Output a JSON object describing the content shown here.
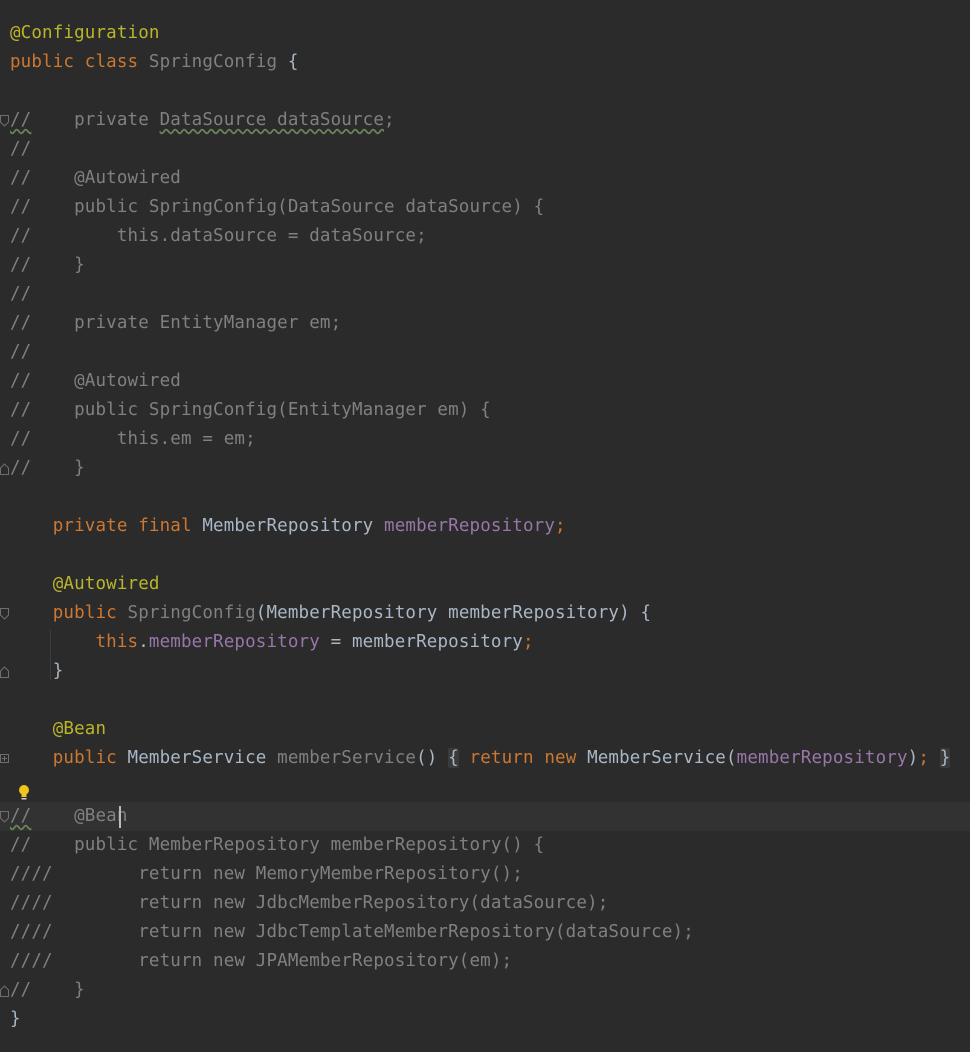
{
  "editor": {
    "language": "java",
    "colors": {
      "background": "#2b2b2b",
      "text": "#a9b7c6",
      "keyword": "#cc7832",
      "annotation": "#bbb529",
      "field": "#9876aa",
      "comment": "#808080"
    },
    "lines": [
      {
        "segs": [
          {
            "t": "@Configuration",
            "c": "ann"
          }
        ]
      },
      {
        "segs": [
          {
            "t": "public class ",
            "c": "kw"
          },
          {
            "t": "SpringConfig",
            "c": "muted"
          },
          {
            "t": " {",
            "c": "txt"
          }
        ]
      },
      {
        "segs": []
      },
      {
        "fold": "start",
        "segs": [
          {
            "t": "//",
            "c": "cmt",
            "u": true
          },
          {
            "t": "    private ",
            "c": "cmt"
          },
          {
            "t": "DataSource dataSource",
            "c": "cmt",
            "u": true
          },
          {
            "t": ";",
            "c": "cmt"
          }
        ]
      },
      {
        "segs": [
          {
            "t": "//",
            "c": "cmt"
          }
        ]
      },
      {
        "segs": [
          {
            "t": "//    @Autowired",
            "c": "cmt"
          }
        ]
      },
      {
        "segs": [
          {
            "t": "//    public SpringConfig(DataSource dataSource) {",
            "c": "cmt"
          }
        ]
      },
      {
        "segs": [
          {
            "t": "//        this.dataSource = dataSource;",
            "c": "cmt"
          }
        ]
      },
      {
        "segs": [
          {
            "t": "//    }",
            "c": "cmt"
          }
        ]
      },
      {
        "segs": [
          {
            "t": "//",
            "c": "cmt"
          }
        ]
      },
      {
        "segs": [
          {
            "t": "//    private EntityManager em;",
            "c": "cmt"
          }
        ]
      },
      {
        "segs": [
          {
            "t": "//",
            "c": "cmt"
          }
        ]
      },
      {
        "segs": [
          {
            "t": "//    @Autowired",
            "c": "cmt"
          }
        ]
      },
      {
        "segs": [
          {
            "t": "//    public SpringConfig(EntityManager em) {",
            "c": "cmt"
          }
        ]
      },
      {
        "segs": [
          {
            "t": "//        this.em = em;",
            "c": "cmt"
          }
        ]
      },
      {
        "fold": "end",
        "segs": [
          {
            "t": "//    }",
            "c": "cmt"
          }
        ]
      },
      {
        "segs": []
      },
      {
        "segs": [
          {
            "t": "    private final ",
            "c": "kw"
          },
          {
            "t": "MemberRepository ",
            "c": "txt"
          },
          {
            "t": "memberRepository",
            "c": "field"
          },
          {
            "t": ";",
            "c": "kw"
          }
        ]
      },
      {
        "segs": []
      },
      {
        "segs": [
          {
            "t": "    @Autowired",
            "c": "ann"
          }
        ]
      },
      {
        "fold": "start",
        "segs": [
          {
            "t": "    public ",
            "c": "kw"
          },
          {
            "t": "SpringConfig",
            "c": "muted"
          },
          {
            "t": "(MemberRepository memberRepository) {",
            "c": "txt"
          }
        ]
      },
      {
        "segs": [
          {
            "t": "        this",
            "c": "kw"
          },
          {
            "t": ".",
            "c": "txt"
          },
          {
            "t": "memberRepository",
            "c": "field"
          },
          {
            "t": " = memberRepository",
            "c": "txt"
          },
          {
            "t": ";",
            "c": "kw"
          }
        ]
      },
      {
        "fold": "end",
        "segs": [
          {
            "t": "    }",
            "c": "txt"
          }
        ]
      },
      {
        "segs": []
      },
      {
        "segs": [
          {
            "t": "    @Bean",
            "c": "ann"
          }
        ]
      },
      {
        "fold": "plus",
        "segs": [
          {
            "t": "    public ",
            "c": "kw"
          },
          {
            "t": "MemberService ",
            "c": "txt"
          },
          {
            "t": "memberService",
            "c": "muted"
          },
          {
            "t": "() ",
            "c": "txt"
          },
          {
            "t": "{",
            "c": "txt",
            "box": true
          },
          {
            "t": " ",
            "c": "txt"
          },
          {
            "t": "return new ",
            "c": "kw"
          },
          {
            "t": "MemberService(",
            "c": "txt"
          },
          {
            "t": "memberRepository",
            "c": "field"
          },
          {
            "t": ")",
            "c": "txt"
          },
          {
            "t": ";",
            "c": "kw"
          },
          {
            "t": " ",
            "c": "txt"
          },
          {
            "t": "}",
            "c": "txt",
            "box": true
          }
        ]
      },
      {
        "segs": []
      },
      {
        "current": true,
        "fold": "start",
        "segs": [
          {
            "t": "//",
            "c": "cmt",
            "u": true
          },
          {
            "t": "    @Bean",
            "c": "cmt"
          }
        ]
      },
      {
        "segs": [
          {
            "t": "//    public MemberRepository memberRepository() {",
            "c": "cmt"
          }
        ]
      },
      {
        "segs": [
          {
            "t": "////        return new MemoryMemberRepository();",
            "c": "cmt"
          }
        ]
      },
      {
        "segs": [
          {
            "t": "////        return new JdbcMemberRepository(dataSource);",
            "c": "cmt"
          }
        ]
      },
      {
        "segs": [
          {
            "t": "////        return new JdbcTemplateMemberRepository(dataSource);",
            "c": "cmt"
          }
        ]
      },
      {
        "segs": [
          {
            "t": "////        return new JPAMemberRepository(em);",
            "c": "cmt"
          }
        ]
      },
      {
        "fold": "end",
        "segs": [
          {
            "t": "//    }",
            "c": "cmt"
          }
        ]
      },
      {
        "segs": [
          {
            "t": "}",
            "c": "txt"
          }
        ]
      }
    ],
    "gutter_icons": {
      "intention_bulb": "lightbulb-icon"
    }
  }
}
